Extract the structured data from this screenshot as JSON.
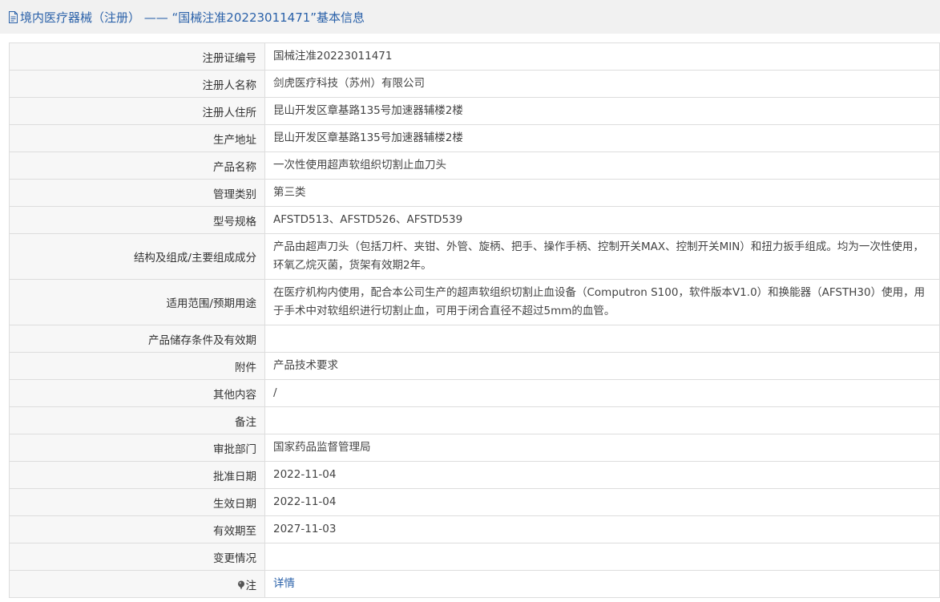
{
  "header": {
    "title": "境内医疗器械（注册） ——  “国械注准20223011471”基本信息"
  },
  "rows": [
    {
      "label": "注册证编号",
      "value": "国械注准20223011471"
    },
    {
      "label": "注册人名称",
      "value": "剑虎医疗科技（苏州）有限公司"
    },
    {
      "label": "注册人住所",
      "value": "昆山开发区章基路135号加速器辅楼2楼"
    },
    {
      "label": "生产地址",
      "value": "昆山开发区章基路135号加速器辅楼2楼"
    },
    {
      "label": "产品名称",
      "value": "一次性使用超声软组织切割止血刀头"
    },
    {
      "label": "管理类别",
      "value": "第三类"
    },
    {
      "label": "型号规格",
      "value": "AFSTD513、AFSTD526、AFSTD539"
    },
    {
      "label": "结构及组成/主要组成成分",
      "value": "产品由超声刀头（包括刀杆、夹钳、外管、旋柄、把手、操作手柄、控制开关MAX、控制开关MIN）和扭力扳手组成。均为一次性使用，环氧乙烷灭菌，货架有效期2年。"
    },
    {
      "label": "适用范围/预期用途",
      "value": "在医疗机构内使用，配合本公司生产的超声软组织切割止血设备（Computron S100，软件版本V1.0）和换能器（AFSTH30）使用，用于手术中对软组织进行切割止血，可用于闭合直径不超过5mm的血管。"
    },
    {
      "label": "产品储存条件及有效期",
      "value": ""
    },
    {
      "label": "附件",
      "value": "产品技术要求"
    },
    {
      "label": "其他内容",
      "value": "/"
    },
    {
      "label": "备注",
      "value": ""
    },
    {
      "label": "审批部门",
      "value": "国家药品监督管理局"
    },
    {
      "label": "批准日期",
      "value": "2022-11-04"
    },
    {
      "label": "生效日期",
      "value": "2022-11-04"
    },
    {
      "label": "有效期至",
      "value": "2027-11-03"
    },
    {
      "label": "变更情况",
      "value": ""
    }
  ],
  "note_row": {
    "label": "注",
    "link_text": "详情",
    "icon": "pin-icon"
  },
  "colors": {
    "link": "#2a61a9",
    "label_bg": "#f7f7f7",
    "header_bg": "#f1f1f1",
    "border": "#dddddd"
  }
}
